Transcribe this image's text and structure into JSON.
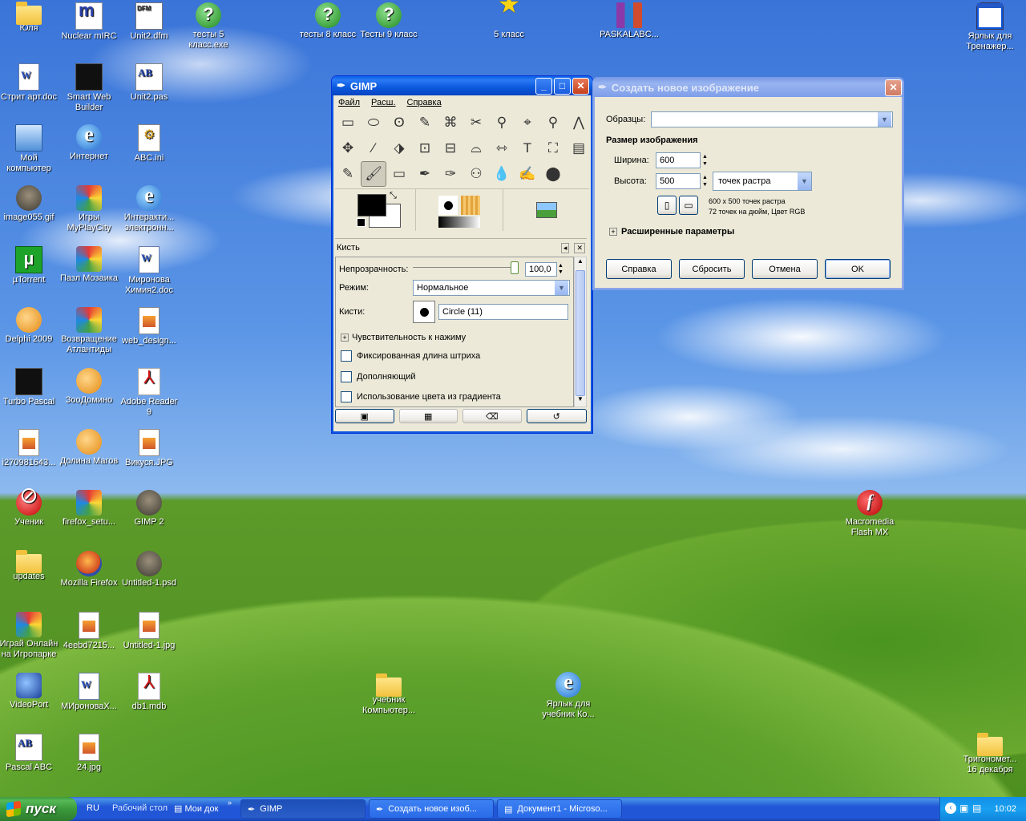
{
  "desktop_icons": [
    {
      "label": "Юля",
      "icon": "folder"
    },
    {
      "label": "Nuclear mIRC",
      "icon": "mirc"
    },
    {
      "label": "Unit2.dfm",
      "icon": "dfm"
    },
    {
      "label": "тесты 5 класс.exe",
      "icon": "help"
    },
    {
      "label": "тесты 8 класс",
      "icon": "help"
    },
    {
      "label": "Тесты 9 класс",
      "icon": "help"
    },
    {
      "label": "5 класс",
      "icon": "star"
    },
    {
      "label": "PASKALABC...",
      "icon": "rar"
    },
    {
      "label": "Ярлык для Тренажер...",
      "icon": "win"
    },
    {
      "label": "Стрит арт.doc",
      "icon": "doc"
    },
    {
      "label": "Smart Web Builder",
      "icon": "black"
    },
    {
      "label": "Unit2.pas",
      "icon": "abc"
    },
    {
      "label": "Мой компьютер",
      "icon": "pc"
    },
    {
      "label": "Интернет",
      "icon": "ie"
    },
    {
      "label": "ABC.ini",
      "icon": "ini"
    },
    {
      "label": "image055.gif",
      "icon": "gimp"
    },
    {
      "label": "Игры MyPlayCity",
      "icon": "colorful"
    },
    {
      "label": "Интеракти... электронн...",
      "icon": "ie"
    },
    {
      "label": "µTorrent",
      "icon": "green"
    },
    {
      "label": "Пазл Мозаика",
      "icon": "colorful"
    },
    {
      "label": "Миронова Химия2.doc",
      "icon": "doc"
    },
    {
      "label": "Delphi 2009",
      "icon": "orange"
    },
    {
      "label": "Возвращение Атлантиды",
      "icon": "colorful"
    },
    {
      "label": "web_design...",
      "icon": "img"
    },
    {
      "label": "Turbo Pascal",
      "icon": "black"
    },
    {
      "label": "ЗооДомино",
      "icon": "orange"
    },
    {
      "label": "Adobe Reader 9",
      "icon": "pdf"
    },
    {
      "label": "i270981643...",
      "icon": "img"
    },
    {
      "label": "Долина Магов",
      "icon": "orange"
    },
    {
      "label": "Викуся.JPG",
      "icon": "img"
    },
    {
      "label": "Ученик",
      "icon": "red"
    },
    {
      "label": "firefox_setu...",
      "icon": "colorful"
    },
    {
      "label": "GIMP 2",
      "icon": "gimp"
    },
    {
      "label": "updates",
      "icon": "folder"
    },
    {
      "label": "Mozilla Firefox",
      "icon": "fox"
    },
    {
      "label": "Untitled-1.psd",
      "icon": "gimp"
    },
    {
      "label": "Играй Онлайн на Игропарке",
      "icon": "colorful"
    },
    {
      "label": "4eebd7215...",
      "icon": "img"
    },
    {
      "label": "Untitled-1.jpg",
      "icon": "img"
    },
    {
      "label": "VideoPort",
      "icon": "blueobj"
    },
    {
      "label": "МИроноваХ...",
      "icon": "doc"
    },
    {
      "label": "db1.mdb",
      "icon": "pdf"
    },
    {
      "label": "Pascal ABC",
      "icon": "abc"
    },
    {
      "label": "24.jpg",
      "icon": "img"
    },
    {
      "label": "учебник Компьютер...",
      "icon": "folder"
    },
    {
      "label": "Ярлык для учебник Ко...",
      "icon": "ie"
    },
    {
      "label": "Macromedia Flash MX",
      "icon": "flash"
    },
    {
      "label": "Тригономет... 16 декабря",
      "icon": "folder"
    }
  ],
  "gimp": {
    "title": "GIMP",
    "menu": [
      "Файл",
      "Расш.",
      "Справка"
    ],
    "tools": [
      "▭",
      "⬭",
      "ʘ",
      "✎",
      "⌘",
      "✂",
      "⚲",
      "⌖",
      "⚲",
      "⋀",
      "✥",
      "⁄",
      "⬗",
      "⊡",
      "⊟",
      "⌓",
      "⇿",
      "T",
      "⛶",
      "▤",
      "✎",
      "🖌",
      "▭",
      "✒",
      "✑",
      "⚇",
      "💧",
      "✍",
      "⬤"
    ],
    "dock": {
      "title": "Кисть",
      "opacity_label": "Непрозрачность:",
      "opacity_value": "100,0",
      "mode_label": "Режим:",
      "mode_value": "Нормальное",
      "brush_label": "Кисти:",
      "brush_value": "Circle (11)",
      "pressure_label": "Чувствительность к нажиму",
      "fixed_label": "Фиксированная длина штриха",
      "incremental_label": "Дополняющий",
      "gradient_label": "Использование цвета из градиента"
    }
  },
  "new_image_dialog": {
    "title": "Создать новое изображение",
    "templates_label": "Образцы:",
    "templates_value": "",
    "size_heading": "Размер изображения",
    "width_label": "Ширина:",
    "width_value": "600",
    "height_label": "Высота:",
    "height_value": "500",
    "unit_value": "точек растра",
    "info_line1": "600 x 500 точек растра",
    "info_line2": "72 точек на дюйм, Цвет RGB",
    "advanced_label": "Расширенные параметры",
    "buttons": {
      "help": "Справка",
      "reset": "Сбросить",
      "cancel": "Отмена",
      "ok": "OK"
    }
  },
  "taskbar": {
    "start_label": "пуск",
    "lang": "RU",
    "quick": [
      "Рабочий стол",
      "Мои док"
    ],
    "tasks": [
      "GIMP",
      "Создать новое изоб...",
      "Документ1 - Microso..."
    ],
    "clock": "10:02"
  }
}
